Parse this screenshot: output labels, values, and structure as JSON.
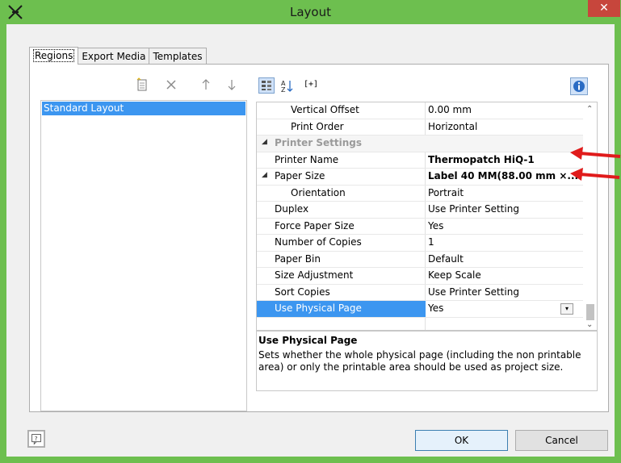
{
  "window": {
    "title": "Layout",
    "close_symbol": "✕"
  },
  "tabs": [
    "Regions",
    "Export Media",
    "Templates"
  ],
  "left_list": {
    "items": [
      "Standard Layout"
    ]
  },
  "properties": {
    "rows": [
      {
        "name": "Vertical Offset",
        "value": "0.00 mm",
        "indent": 2,
        "type": "prop"
      },
      {
        "name": "Print Order",
        "value": "Horizontal",
        "indent": 2,
        "type": "prop"
      },
      {
        "name": "Printer Settings",
        "value": "",
        "indent": 0,
        "type": "category"
      },
      {
        "name": "Printer Name",
        "value": "Thermopatch HiQ-1",
        "indent": 1,
        "type": "prop",
        "bold_value": true
      },
      {
        "name": "Paper Size",
        "value": "Label 40 MM(88.00 mm ×...",
        "indent": 1,
        "type": "prop",
        "bold_value": true,
        "expandable": true
      },
      {
        "name": "Orientation",
        "value": "Portrait",
        "indent": 2,
        "type": "prop"
      },
      {
        "name": "Duplex",
        "value": "Use Printer Setting",
        "indent": 1,
        "type": "prop"
      },
      {
        "name": "Force Paper Size",
        "value": "Yes",
        "indent": 1,
        "type": "prop"
      },
      {
        "name": "Number of Copies",
        "value": "1",
        "indent": 1,
        "type": "prop"
      },
      {
        "name": "Paper Bin",
        "value": "Default",
        "indent": 1,
        "type": "prop"
      },
      {
        "name": "Size Adjustment",
        "value": "Keep Scale",
        "indent": 1,
        "type": "prop"
      },
      {
        "name": "Sort Copies",
        "value": "Use Printer Setting",
        "indent": 1,
        "type": "prop"
      },
      {
        "name": "Use Physical Page",
        "value": "Yes",
        "indent": 1,
        "type": "prop",
        "selected": true
      }
    ]
  },
  "description": {
    "title": "Use Physical Page",
    "text": "Sets whether the whole physical page (including the non printable area) or only the printable area should be used as project size."
  },
  "buttons": {
    "ok": "OK",
    "cancel": "Cancel"
  },
  "toolbar_right": {
    "expand_label": "[+]"
  },
  "colors": {
    "selection": "#3c96f0",
    "annotation_arrow": "#e01b1b",
    "frame": "#6dbf4f"
  },
  "icons": [
    "app-icon",
    "new-item-icon",
    "delete-icon",
    "move-up-icon",
    "move-down-icon",
    "categorized-view-icon",
    "sort-az-icon",
    "info-icon",
    "help-icon",
    "dropdown-icon"
  ]
}
